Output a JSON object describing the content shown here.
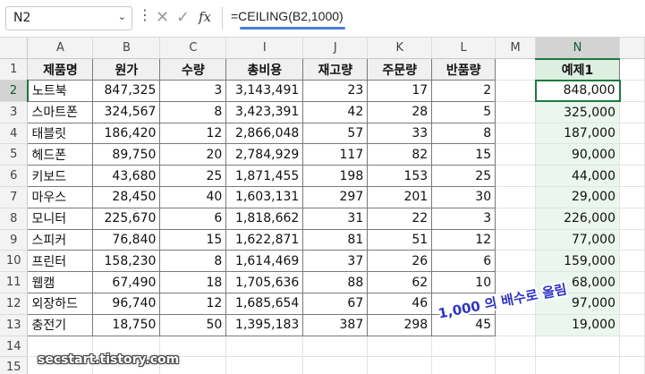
{
  "namebox": {
    "value": "N2",
    "arrow": "⌄"
  },
  "formula_bar": {
    "dots": "⋮",
    "cancel": "✕",
    "enter": "✓",
    "fx": "fx",
    "formula": "=CEILING(B2,1000)"
  },
  "columns": [
    "A",
    "B",
    "C",
    "I",
    "J",
    "K",
    "L",
    "M",
    "N"
  ],
  "rows": [
    "1",
    "2",
    "3",
    "4",
    "5",
    "6",
    "7",
    "8",
    "9",
    "10",
    "11",
    "12",
    "13",
    "14",
    "15"
  ],
  "headers": [
    "제품명",
    "원가",
    "수량",
    "총비용",
    "재고량",
    "주문량",
    "반품량",
    "",
    "예제1"
  ],
  "table": [
    [
      "노트북",
      "847,325",
      "3",
      "3,143,491",
      "23",
      "17",
      "2",
      "",
      "848,000"
    ],
    [
      "스마트폰",
      "324,567",
      "8",
      "3,423,391",
      "42",
      "28",
      "5",
      "",
      "325,000"
    ],
    [
      "태블릿",
      "186,420",
      "12",
      "2,866,048",
      "57",
      "33",
      "8",
      "",
      "187,000"
    ],
    [
      "헤드폰",
      "89,750",
      "20",
      "2,784,929",
      "117",
      "82",
      "15",
      "",
      "90,000"
    ],
    [
      "키보드",
      "43,680",
      "25",
      "1,871,455",
      "198",
      "153",
      "25",
      "",
      "44,000"
    ],
    [
      "마우스",
      "28,450",
      "40",
      "1,603,131",
      "297",
      "201",
      "30",
      "",
      "29,000"
    ],
    [
      "모니터",
      "225,670",
      "6",
      "1,818,662",
      "31",
      "22",
      "3",
      "",
      "226,000"
    ],
    [
      "스피커",
      "76,840",
      "15",
      "1,622,871",
      "81",
      "51",
      "12",
      "",
      "77,000"
    ],
    [
      "프린터",
      "158,230",
      "8",
      "1,614,469",
      "37",
      "26",
      "6",
      "",
      "159,000"
    ],
    [
      "웹캠",
      "67,490",
      "18",
      "1,705,636",
      "88",
      "62",
      "10",
      "",
      "68,000"
    ],
    [
      "외장하드",
      "96,740",
      "12",
      "1,685,654",
      "67",
      "46",
      "8",
      "",
      "97,000"
    ],
    [
      "충전기",
      "18,750",
      "50",
      "1,395,183",
      "387",
      "298",
      "45",
      "",
      "19,000"
    ]
  ],
  "annotation": "1,000 의 배수로 올림",
  "watermark": "secstart.tistory.com",
  "colors": {
    "accent": "#1b7a3d",
    "n_fill": "#eaf6ee",
    "annot": "#2e35c8"
  }
}
